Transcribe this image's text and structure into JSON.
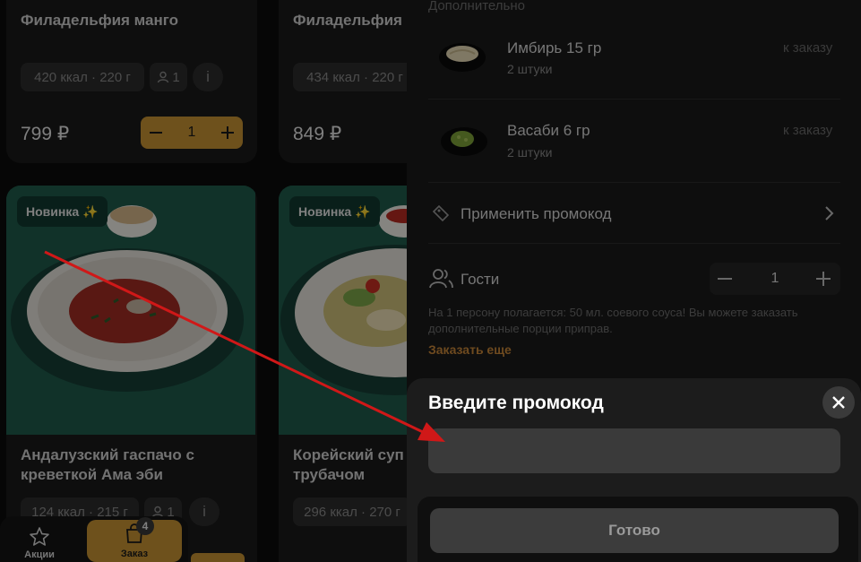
{
  "products_top": [
    {
      "name": "Филадельфия манго",
      "nutrition": "420 ккал · 220 г",
      "persons": "1",
      "price": "799 ₽",
      "quantity": "1"
    },
    {
      "name": "Филадельфия м",
      "nutrition": "434 ккал · 220 г",
      "price": "849 ₽"
    }
  ],
  "products_bottom": [
    {
      "badge": "Новинка",
      "badge_icon": "✨",
      "name": "Андалузский гаспачо с креветкой Ама эби",
      "nutrition": "124 ккал · 215 г",
      "persons": "1"
    },
    {
      "badge": "Новинка",
      "badge_icon": "✨",
      "name": "Корейский суп",
      "name_line2": "трубачом",
      "nutrition": "296 ккал · 270 г"
    }
  ],
  "cart": {
    "section_label": "Дополнительно",
    "extras": [
      {
        "name": "Имбирь 15 гр",
        "qty": "2 штуки",
        "action": "к заказу"
      },
      {
        "name": "Васаби 6 гр",
        "qty": "2 штуки",
        "action": "к заказу"
      }
    ],
    "promo_label": "Применить промокод",
    "guests_label": "Гости",
    "guests_count": "1",
    "note": "На 1 персону полагается: 50 мл. соевого соуса! Вы можете заказать дополнительные порции приправ.",
    "order_more": "Заказать еще"
  },
  "promo_sheet": {
    "title": "Введите промокод",
    "input_value": "",
    "done_label": "Готово"
  },
  "bottom_nav": {
    "items": [
      {
        "label": "Акции",
        "icon": "star-icon"
      },
      {
        "label": "Заказ",
        "icon": "bag-icon",
        "badge": "4"
      }
    ]
  },
  "colors": {
    "accent": "#c99433",
    "order_more": "#c9873a",
    "annotation_arrow": "#d01818",
    "background": "#0c0c0c"
  }
}
